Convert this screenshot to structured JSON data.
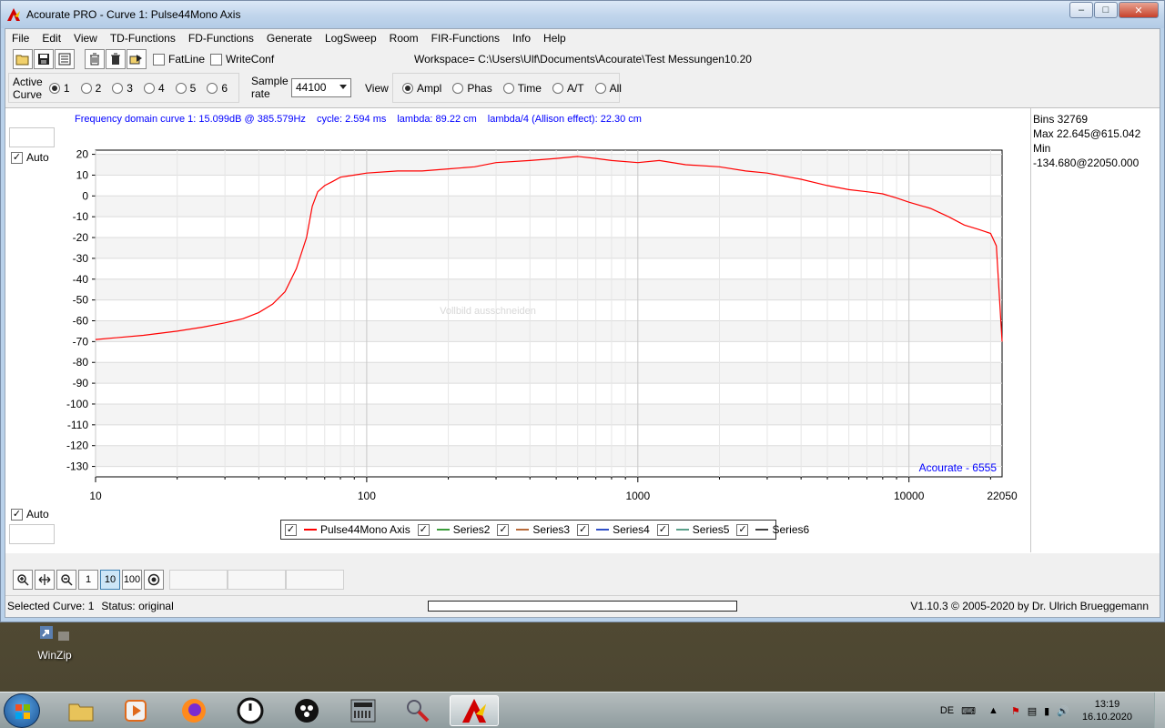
{
  "window": {
    "title": "Acourate PRO - Curve 1: Pulse44Mono Axis",
    "minimize": "–",
    "maximize": "□",
    "close": "✕"
  },
  "menu": [
    "File",
    "Edit",
    "View",
    "TD-Functions",
    "FD-Functions",
    "Generate",
    "LogSweep",
    "Room",
    "FIR-Functions",
    "Info",
    "Help"
  ],
  "toolbar": {
    "fatline_label": "FatLine",
    "writeconf_label": "WriteConf",
    "workspace_label": "Workspace=",
    "workspace_path": "C:\\Users\\Ulf\\Documents\\Acourate\\Test Messungen10.20"
  },
  "curve_bar": {
    "active_label_1": "Active",
    "active_label_2": "Curve",
    "curves": [
      "1",
      "2",
      "3",
      "4",
      "5",
      "6"
    ],
    "selected_curve": "1",
    "sample_label_1": "Sample",
    "sample_label_2": "rate",
    "sample_rate": "44100",
    "view_label": "View",
    "views": [
      "Ampl",
      "Phas",
      "Time",
      "A/T",
      "All"
    ],
    "selected_view": "Ampl"
  },
  "info": {
    "freq": "Frequency domain curve 1:  15.099dB @ 385.579Hz",
    "cycle": "cycle: 2.594 ms",
    "lambda": "lambda: 89.22 cm",
    "lambda4": "lambda/4 (Allison effect): 22.30 cm"
  },
  "side": {
    "bins": "Bins 32769",
    "max": "Max 22.645@615.042",
    "min": "Min -134.680@22050.000"
  },
  "auto_top": "Auto",
  "auto_bottom": "Auto",
  "watermark": "Vollbild ausschneiden",
  "brand": "Acourate - 6555",
  "chart_data": {
    "type": "line",
    "xscale": "log",
    "xlim": [
      10,
      22050
    ],
    "ylim": [
      -135,
      22
    ],
    "x_ticks": [
      "10",
      "100",
      "1000",
      "10000",
      "22050"
    ],
    "x_tick_values": [
      10,
      100,
      1000,
      10000,
      22050
    ],
    "y_ticks": [
      20,
      10,
      0,
      -10,
      -20,
      -30,
      -40,
      -50,
      -60,
      -70,
      -80,
      -90,
      -100,
      -110,
      -120,
      -130
    ],
    "grid": true,
    "series": [
      {
        "name": "Pulse44Mono Axis",
        "color": "#ff0000",
        "x": [
          10,
          15,
          20,
          25,
          30,
          35,
          40,
          45,
          50,
          55,
          60,
          63,
          66,
          70,
          75,
          80,
          90,
          100,
          130,
          160,
          200,
          250,
          300,
          400,
          500,
          600,
          700,
          800,
          1000,
          1200,
          1500,
          2000,
          2500,
          3000,
          4000,
          5000,
          6000,
          7000,
          8000,
          9000,
          10000,
          12000,
          14000,
          16000,
          18000,
          20000,
          21000,
          22050
        ],
        "y": [
          -69,
          -67,
          -65,
          -63,
          -61,
          -59,
          -56,
          -52,
          -46,
          -35,
          -20,
          -5,
          2,
          5,
          7,
          9,
          10,
          11,
          12,
          12,
          13,
          14,
          16,
          17,
          18,
          19,
          18,
          17,
          16,
          17,
          15,
          14,
          12,
          11,
          8,
          5,
          3,
          2,
          1,
          -1,
          -3,
          -6,
          -10,
          -14,
          -16,
          -18,
          -24,
          -70
        ]
      },
      {
        "name": "Series2",
        "color": "#3c9d3c",
        "x": [],
        "y": []
      },
      {
        "name": "Series3",
        "color": "#b86b3a",
        "x": [],
        "y": []
      },
      {
        "name": "Series4",
        "color": "#3050c8",
        "x": [],
        "y": []
      },
      {
        "name": "Series5",
        "color": "#5aa08a",
        "x": [],
        "y": []
      },
      {
        "name": "Series6",
        "color": "#404040",
        "x": [],
        "y": []
      }
    ]
  },
  "zoom": {
    "b1": "1",
    "b10": "10",
    "b100": "100"
  },
  "status": {
    "selected": "Selected Curve: 1",
    "state": "Status: original",
    "version": "V1.10.3 © 2005-2020 by Dr. Ulrich Brueggemann"
  },
  "desktop": {
    "winzip": "WinZip"
  },
  "tray": {
    "lang": "DE",
    "time": "13:19",
    "date": "16.10.2020"
  }
}
